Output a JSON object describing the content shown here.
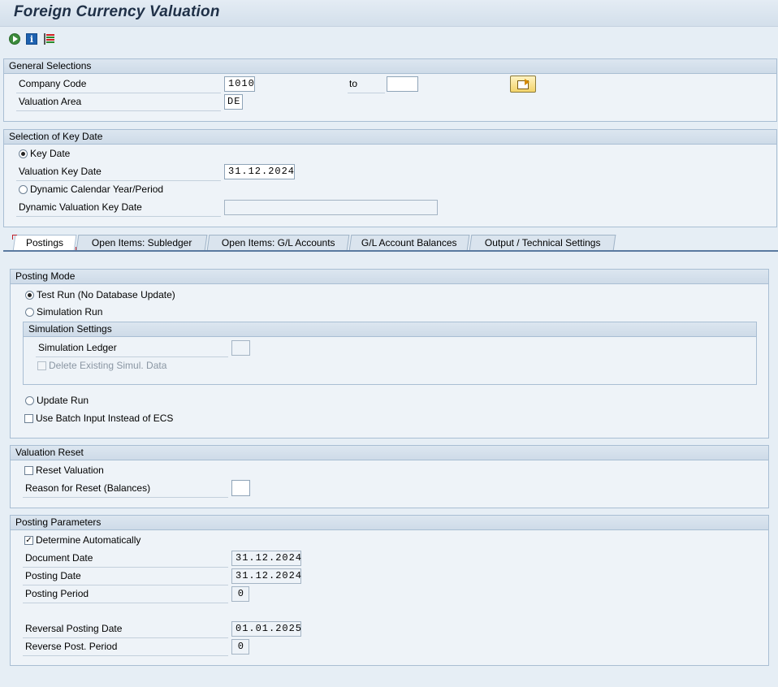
{
  "window": {
    "title": "Foreign Currency Valuation"
  },
  "toolbar": {
    "icons": [
      "execute-icon",
      "info-icon",
      "variant-icon"
    ]
  },
  "general_selections": {
    "header": "General Selections",
    "company_code_label": "Company Code",
    "company_code_from": "1010",
    "to_label": "to",
    "company_code_to": "",
    "valuation_area_label": "Valuation Area",
    "valuation_area": "DE"
  },
  "key_date": {
    "header": "Selection of Key Date",
    "key_date_radio": "Key Date",
    "valuation_key_date_label": "Valuation Key Date",
    "valuation_key_date": "31.12.2024",
    "dynamic_radio": "Dynamic Calendar Year/Period",
    "dynamic_key_date_label": "Dynamic Valuation Key Date",
    "dynamic_key_date": ""
  },
  "tabs": [
    {
      "label": "Postings"
    },
    {
      "label": "Open Items: Subledger"
    },
    {
      "label": "Open Items: G/L Accounts"
    },
    {
      "label": "G/L Account Balances"
    },
    {
      "label": "Output / Technical Settings"
    }
  ],
  "posting_mode": {
    "header": "Posting Mode",
    "test_run": "Test Run (No Database Update)",
    "simulation_run": "Simulation Run",
    "simulation_settings_header": "Simulation Settings",
    "simulation_ledger_label": "Simulation Ledger",
    "simulation_ledger": "",
    "delete_existing": "Delete Existing Simul. Data",
    "update_run": "Update Run",
    "batch_input": "Use Batch Input Instead of ECS"
  },
  "valuation_reset": {
    "header": "Valuation Reset",
    "reset_valuation": "Reset Valuation",
    "reason_label": "Reason for Reset (Balances)",
    "reason": ""
  },
  "posting_parameters": {
    "header": "Posting Parameters",
    "determine_automatically": "Determine Automatically",
    "check_mark": "✓",
    "document_date_label": "Document Date",
    "document_date": "31.12.2024",
    "posting_date_label": "Posting Date",
    "posting_date": "31.12.2024",
    "posting_period_label": "Posting Period",
    "posting_period": "0",
    "reversal_date_label": "Reversal Posting Date",
    "reversal_date": "01.01.2025",
    "reverse_period_label": "Reverse Post. Period",
    "reverse_period": "0"
  }
}
